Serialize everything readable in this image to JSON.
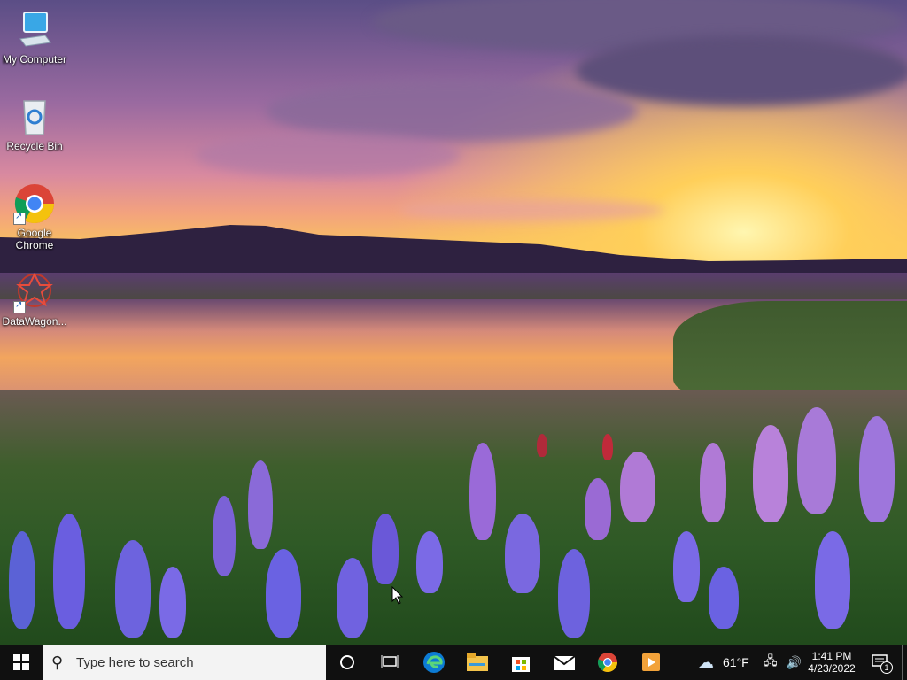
{
  "desktop": {
    "icons": [
      {
        "label": "My Computer"
      },
      {
        "label": "Recycle Bin"
      },
      {
        "label": "Google Chrome"
      },
      {
        "label": "DataWagon..."
      }
    ]
  },
  "taskbar": {
    "search_placeholder": "Type here to search",
    "pinned": [
      "cortana-icon",
      "task-view-icon",
      "edge-icon",
      "file-explorer-icon",
      "store-icon",
      "mail-icon",
      "chrome-icon",
      "media-player-icon"
    ],
    "weather": {
      "temp": "61°F",
      "icon": "partly-cloudy-icon"
    },
    "clock": {
      "time": "1:41 PM",
      "date": "4/23/2022"
    },
    "notifications": {
      "count": "1"
    }
  },
  "colors": {
    "taskbar": "#101010",
    "search_bg": "#f3f3f3",
    "accent": "#0a84ff"
  }
}
